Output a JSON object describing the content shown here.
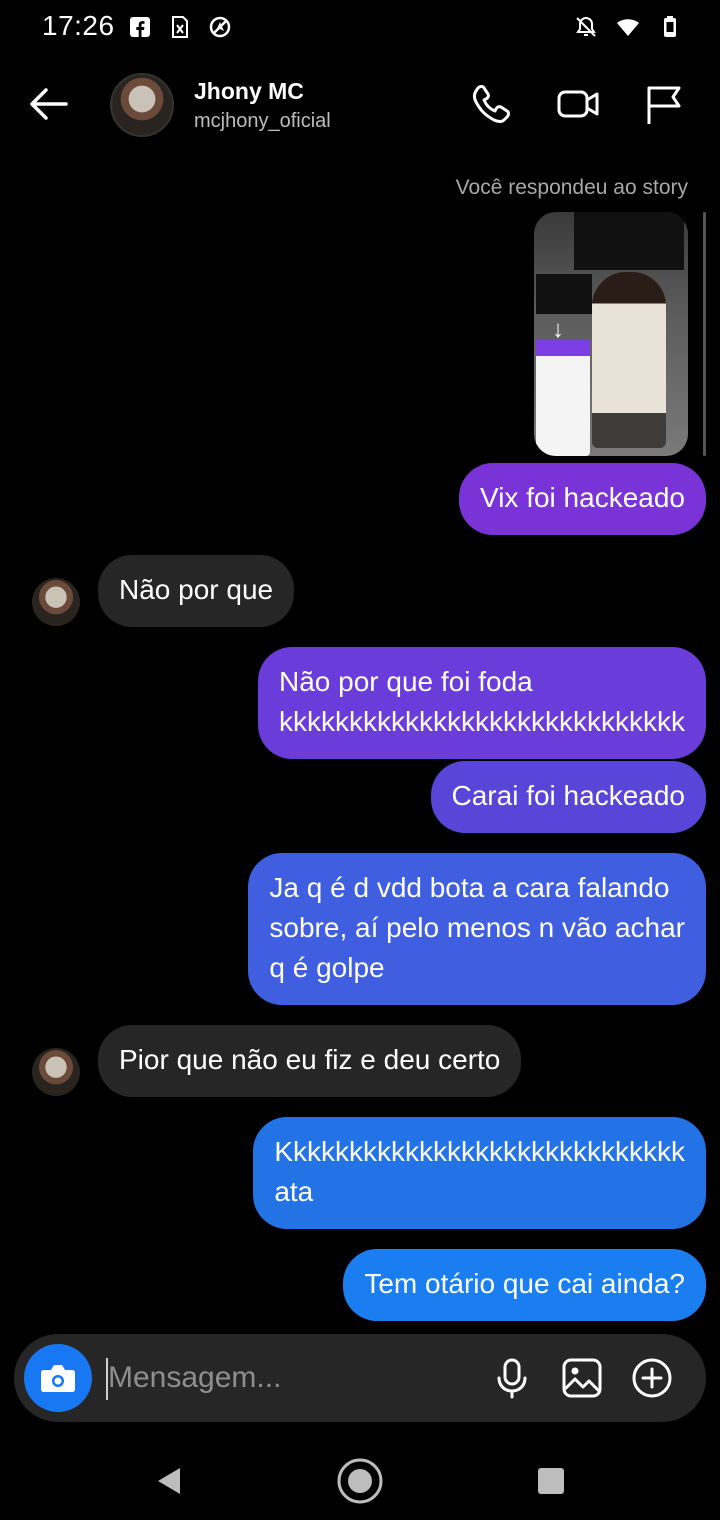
{
  "status_bar": {
    "time": "17:26"
  },
  "header": {
    "name": "Jhony MC",
    "handle": "mcjhony_oficial"
  },
  "story_reply": {
    "label": "Você respondeu ao story"
  },
  "messages": [
    {
      "id": "m1",
      "text": "Vix foi hackeado",
      "direction": "out",
      "color": "#7933d6"
    },
    {
      "id": "m2",
      "text": "Não por que",
      "direction": "in"
    },
    {
      "id": "m3",
      "lines": [
        "Não por que foi foda",
        "kkkkkkkkkkkkkkkkkkkkkkkkkkkkk"
      ],
      "direction": "out",
      "color": "#6a3cd9"
    },
    {
      "id": "m4",
      "text": "Carai foi hackeado",
      "direction": "out",
      "color": "#5a45d9"
    },
    {
      "id": "m5",
      "lines": [
        "Ja q é d vdd bota a cara falando",
        "sobre, aí pelo menos n vão achar",
        "q é golpe"
      ],
      "direction": "out",
      "color": "#3f5ee0"
    },
    {
      "id": "m6",
      "text": "Pior que não eu fiz e deu certo",
      "direction": "in"
    },
    {
      "id": "m7",
      "lines": [
        "Kkkkkkkkkkkkkkkkkkkkkkkkkkkkk",
        "ata"
      ],
      "direction": "out",
      "color": "#2372e6"
    },
    {
      "id": "m8",
      "text": "Tem otário que cai ainda?",
      "direction": "out",
      "color": "#1a7ef0"
    }
  ],
  "composer": {
    "placeholder": "Mensagem..."
  },
  "colors": {
    "background": "#000000",
    "incoming_bubble": "#262626",
    "camera_button": "#1877f2"
  }
}
